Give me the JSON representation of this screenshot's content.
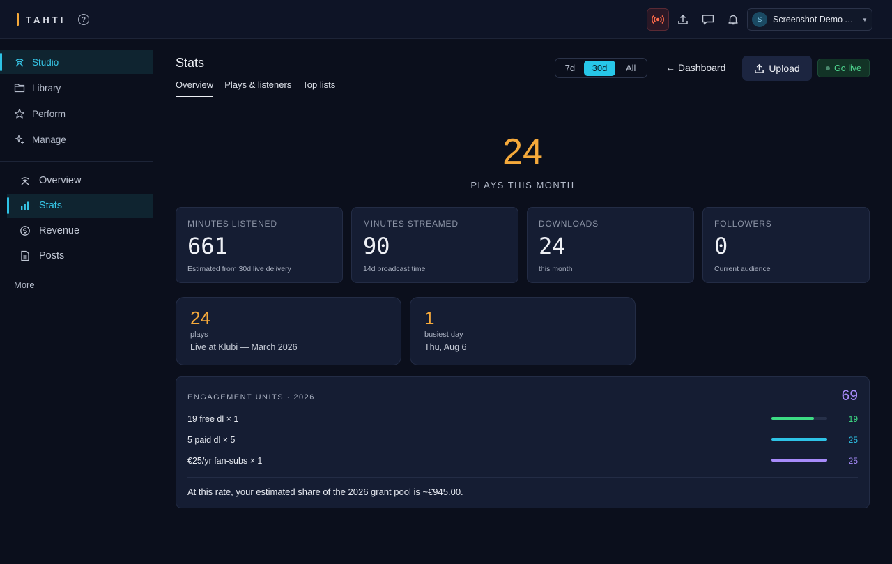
{
  "app": {
    "brand": "TAHTI"
  },
  "topbar": {
    "account_initial": "S",
    "account_name": "Screenshot Demo A…",
    "icons": [
      "broadcast-icon",
      "upload-icon",
      "chat-icon",
      "bell-icon"
    ]
  },
  "sidebar": {
    "items": [
      {
        "label": "Studio",
        "icon": "studio-icon",
        "active": true
      },
      {
        "label": "Library",
        "icon": "folder-icon",
        "active": false
      },
      {
        "label": "Perform",
        "icon": "star-icon",
        "active": false
      },
      {
        "label": "Manage",
        "icon": "sparkle-icon",
        "active": false
      }
    ],
    "sub_items": [
      {
        "label": "Overview",
        "icon": "overview-icon",
        "active": false
      },
      {
        "label": "Stats",
        "icon": "bar-chart-icon",
        "active": true
      },
      {
        "label": "Revenue",
        "icon": "coin-icon",
        "active": false
      },
      {
        "label": "Posts",
        "icon": "document-icon",
        "active": false
      }
    ],
    "more_label": "More"
  },
  "header": {
    "title": "Stats",
    "tabs": [
      {
        "label": "Overview",
        "active": true
      },
      {
        "label": "Plays & listeners",
        "active": false
      },
      {
        "label": "Top lists",
        "active": false
      }
    ],
    "ranges": [
      {
        "label": "7d",
        "active": false
      },
      {
        "label": "30d",
        "active": true
      },
      {
        "label": "All",
        "active": false
      }
    ],
    "back_label": "← Dashboard",
    "upload_label": "Upload",
    "golive_label": "Go live"
  },
  "hero": {
    "value": "24",
    "label": "PLAYS THIS MONTH"
  },
  "stats": [
    {
      "label": "MINUTES LISTENED",
      "value": "661",
      "sub": "Estimated from 30d live delivery"
    },
    {
      "label": "MINUTES STREAMED",
      "value": "90",
      "sub": "14d broadcast time"
    },
    {
      "label": "DOWNLOADS",
      "value": "24",
      "sub": "this month"
    },
    {
      "label": "FOLLOWERS",
      "value": "0",
      "sub": "Current audience"
    }
  ],
  "highlights": [
    {
      "value": "24",
      "label": "plays",
      "sub": "Live at Klubi — March 2026"
    },
    {
      "value": "1",
      "label": "busiest day",
      "sub": "Thu, Aug 6"
    }
  ],
  "engagement": {
    "title": "ENGAGEMENT UNITS · 2026",
    "total": "69",
    "rows": [
      {
        "label": "19 free dl × 1",
        "value": "19",
        "fraction": 0.76,
        "color": "#3ddc84"
      },
      {
        "label": "5 paid dl × 5",
        "value": "25",
        "fraction": 1.0,
        "color": "#2ec3e6"
      },
      {
        "label": "€25/yr fan-subs × 1",
        "value": "25",
        "fraction": 1.0,
        "color": "#a78bfa"
      }
    ],
    "footer": "At this rate, your estimated share of the 2026 grant pool is ~€945.00."
  },
  "colors": {
    "accent": "#2ec3e6",
    "highlight": "#f5a93b",
    "purple": "#a78bfa",
    "green": "#3ddc84",
    "background": "#0b0f1c",
    "card": "#151d33"
  }
}
